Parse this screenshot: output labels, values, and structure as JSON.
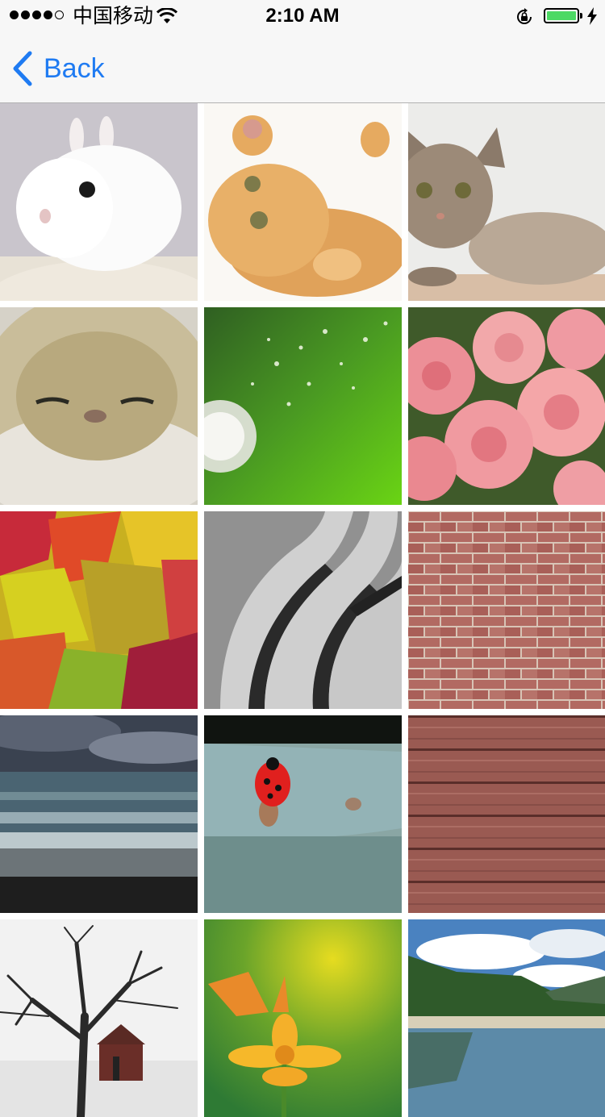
{
  "status_bar": {
    "carrier": "中国移动",
    "time": "2:10 AM",
    "battery_level": 1.0,
    "battery_color": "#4cd964",
    "icons": [
      "signal-icon",
      "wifi-icon",
      "rotation-lock-icon",
      "battery-icon",
      "charging-icon"
    ]
  },
  "nav": {
    "back_label": "Back",
    "accent": "#1f7bf2"
  },
  "photos": [
    {
      "subject": "white-rabbit"
    },
    {
      "subject": "orange-kitten"
    },
    {
      "subject": "tabby-cat"
    },
    {
      "subject": "persian-cat"
    },
    {
      "subject": "dandelion-seeds"
    },
    {
      "subject": "pink-roses"
    },
    {
      "subject": "autumn-leaves"
    },
    {
      "subject": "curved-steps"
    },
    {
      "subject": "brick-wall"
    },
    {
      "subject": "ocean-waves"
    },
    {
      "subject": "ladybug"
    },
    {
      "subject": "wood-planks"
    },
    {
      "subject": "bare-tree"
    },
    {
      "subject": "butterfly-flower"
    },
    {
      "subject": "lake-landscape"
    }
  ]
}
